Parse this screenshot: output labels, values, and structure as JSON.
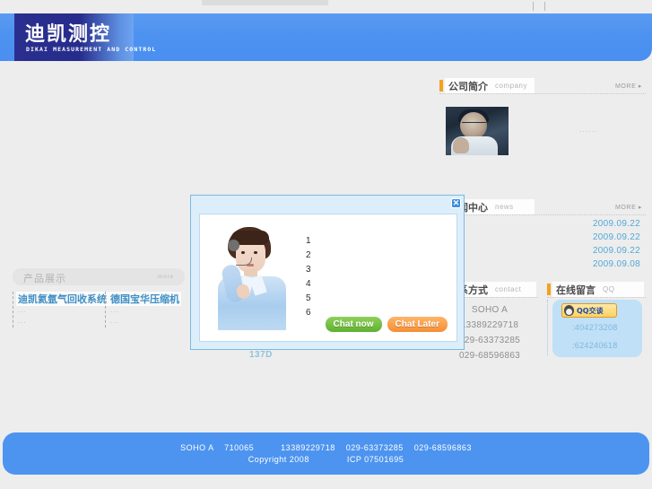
{
  "header": {
    "logo_cn": "迪凯测控",
    "logo_en": "DIKAI MEASUREMENT AND CONTROL"
  },
  "sections": {
    "company": {
      "title_cn": "公司简介",
      "title_en": "company",
      "more": "MORE  ▸",
      "body_placeholder": "......"
    },
    "news": {
      "title_cn": "新闻中心",
      "title_en": "news",
      "more": "MORE  ▸",
      "items": [
        {
          "date": "2009.09.22"
        },
        {
          "date": "2009.09.22"
        },
        {
          "date": "2009.09.22"
        },
        {
          "date": "2009.09.08"
        }
      ]
    },
    "contact": {
      "title_cn": "联系方式",
      "title_en": "contact",
      "address": "SOHO A",
      "phone_mobile": "13389229718",
      "phone_1": "029-63373285",
      "phone_2": "029-68596863"
    },
    "qq": {
      "title_cn": "在线留言",
      "title_en": "QQ",
      "button_label": "QQ交谈",
      "number_1": ":404273208",
      "number_2": ":624240618"
    },
    "products": {
      "title": "产品展示",
      "more": "more",
      "items": [
        {
          "name": "迪凯氦氩气回收系统",
          "sub1": "...",
          "sub2": "..."
        },
        {
          "name": "德国宝华压缩机",
          "sub1": "...",
          "sub2": "..."
        }
      ]
    }
  },
  "misc": {
    "code_137d": "137D"
  },
  "modal": {
    "close_label": "✕",
    "list": "1\n2\n3\n4\n5\n6",
    "chat_now_label": "Chat now",
    "chat_later_label": "Chat Later"
  },
  "footer": {
    "line1": "SOHO A    710065          13389229718    029-63373285    029-68596863",
    "line2": "Copyright 2008              ICP 07501695"
  },
  "colors": {
    "banner_blue": "#4d94f0",
    "logo_navy": "#2a2f8f",
    "accent_orange": "#f5a01e",
    "date_blue": "#53a8d8",
    "product_blue": "#3f8fc4",
    "qq_panel_blue": "#bfe0f7",
    "chat_now_green": "#5fb030",
    "chat_later_orange": "#f58e34",
    "page_gray": "#ededed"
  }
}
